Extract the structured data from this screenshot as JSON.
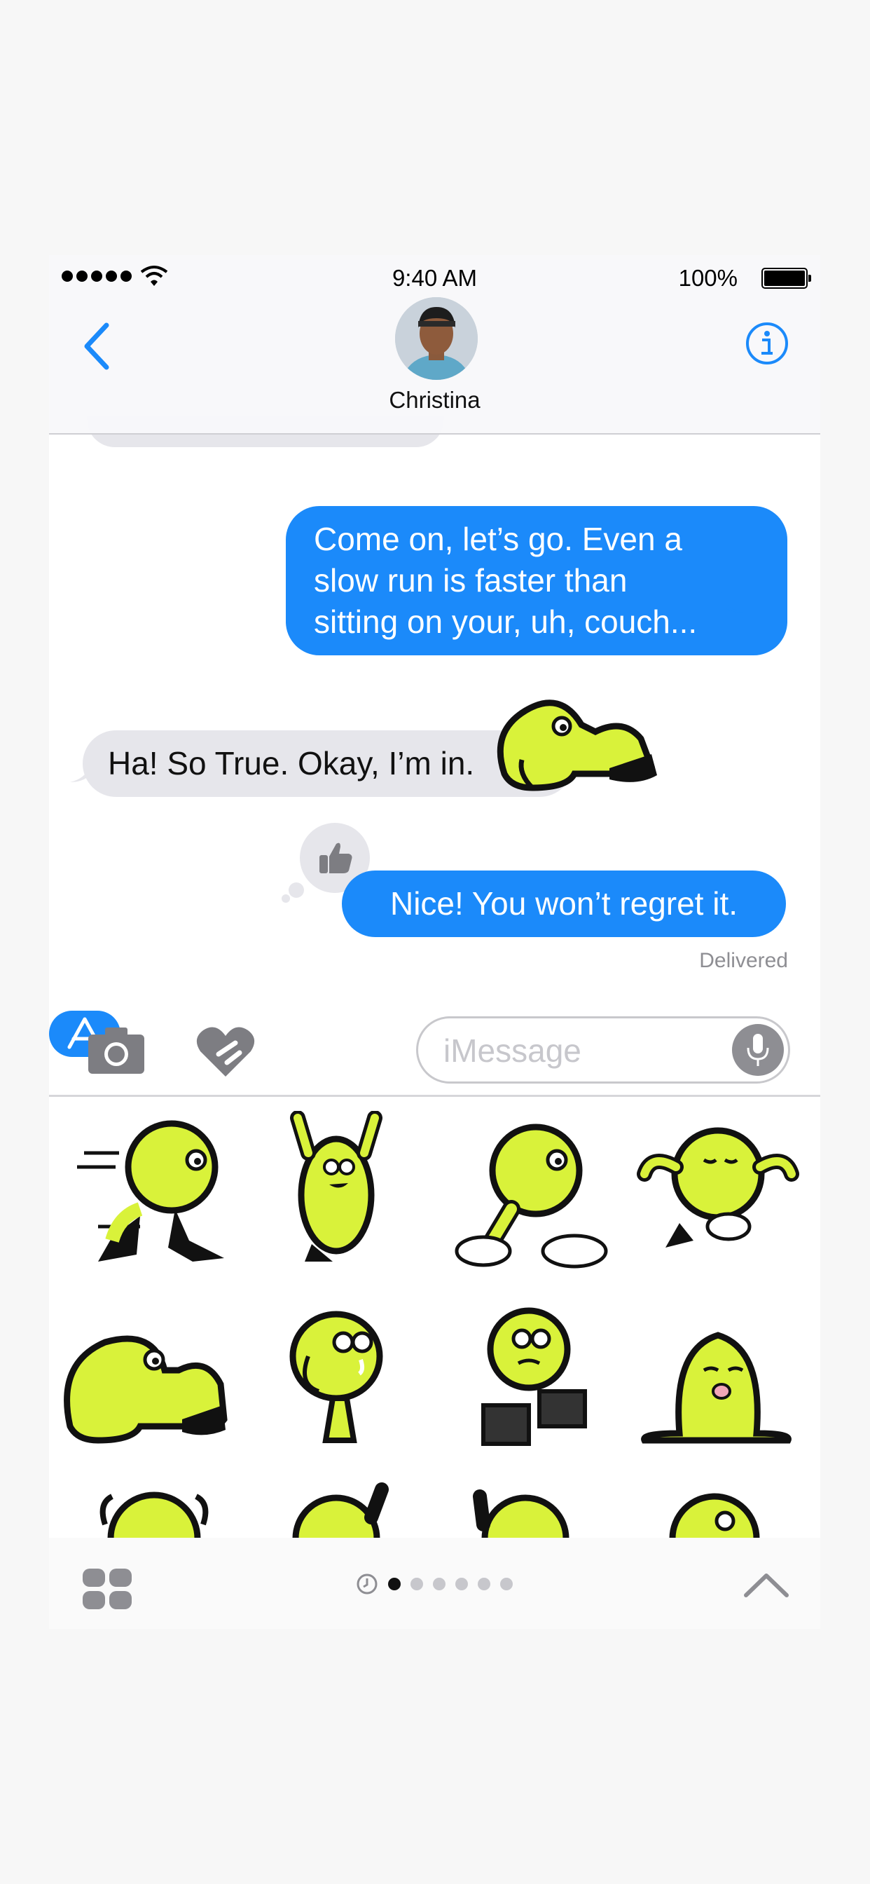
{
  "status_bar": {
    "time": "9:40 AM",
    "battery": "100%"
  },
  "header": {
    "contact_name": "Christina"
  },
  "messages": [
    {
      "side": "sent",
      "lines": [
        "Come on, let’s go. Even a",
        "slow run is faster than",
        "sitting on your, uh, couch..."
      ]
    },
    {
      "side": "received",
      "text": "Ha! So True. Okay, I’m in."
    },
    {
      "side": "sent",
      "text": "Nice! You won’t regret it."
    }
  ],
  "delivery_status": "Delivered",
  "tapback": "thumbs-up-icon",
  "input": {
    "placeholder": "iMessage",
    "value": ""
  },
  "drawer": {
    "stickers": [
      "running-sticker",
      "celebrating-sticker",
      "dust-cloud-sticker",
      "meditating-sticker",
      "stretching-sticker",
      "crying-sticker",
      "blocks-sticker",
      "melting-sticker",
      "partial-sticker",
      "partial-sticker",
      "partial-sticker",
      "partial-sticker"
    ],
    "page_count": 6,
    "active_page": 1
  },
  "colors": {
    "accent": "#1b8afa",
    "sticker_green": "#d9f23a",
    "bubble_gray": "#e6e6eb"
  }
}
